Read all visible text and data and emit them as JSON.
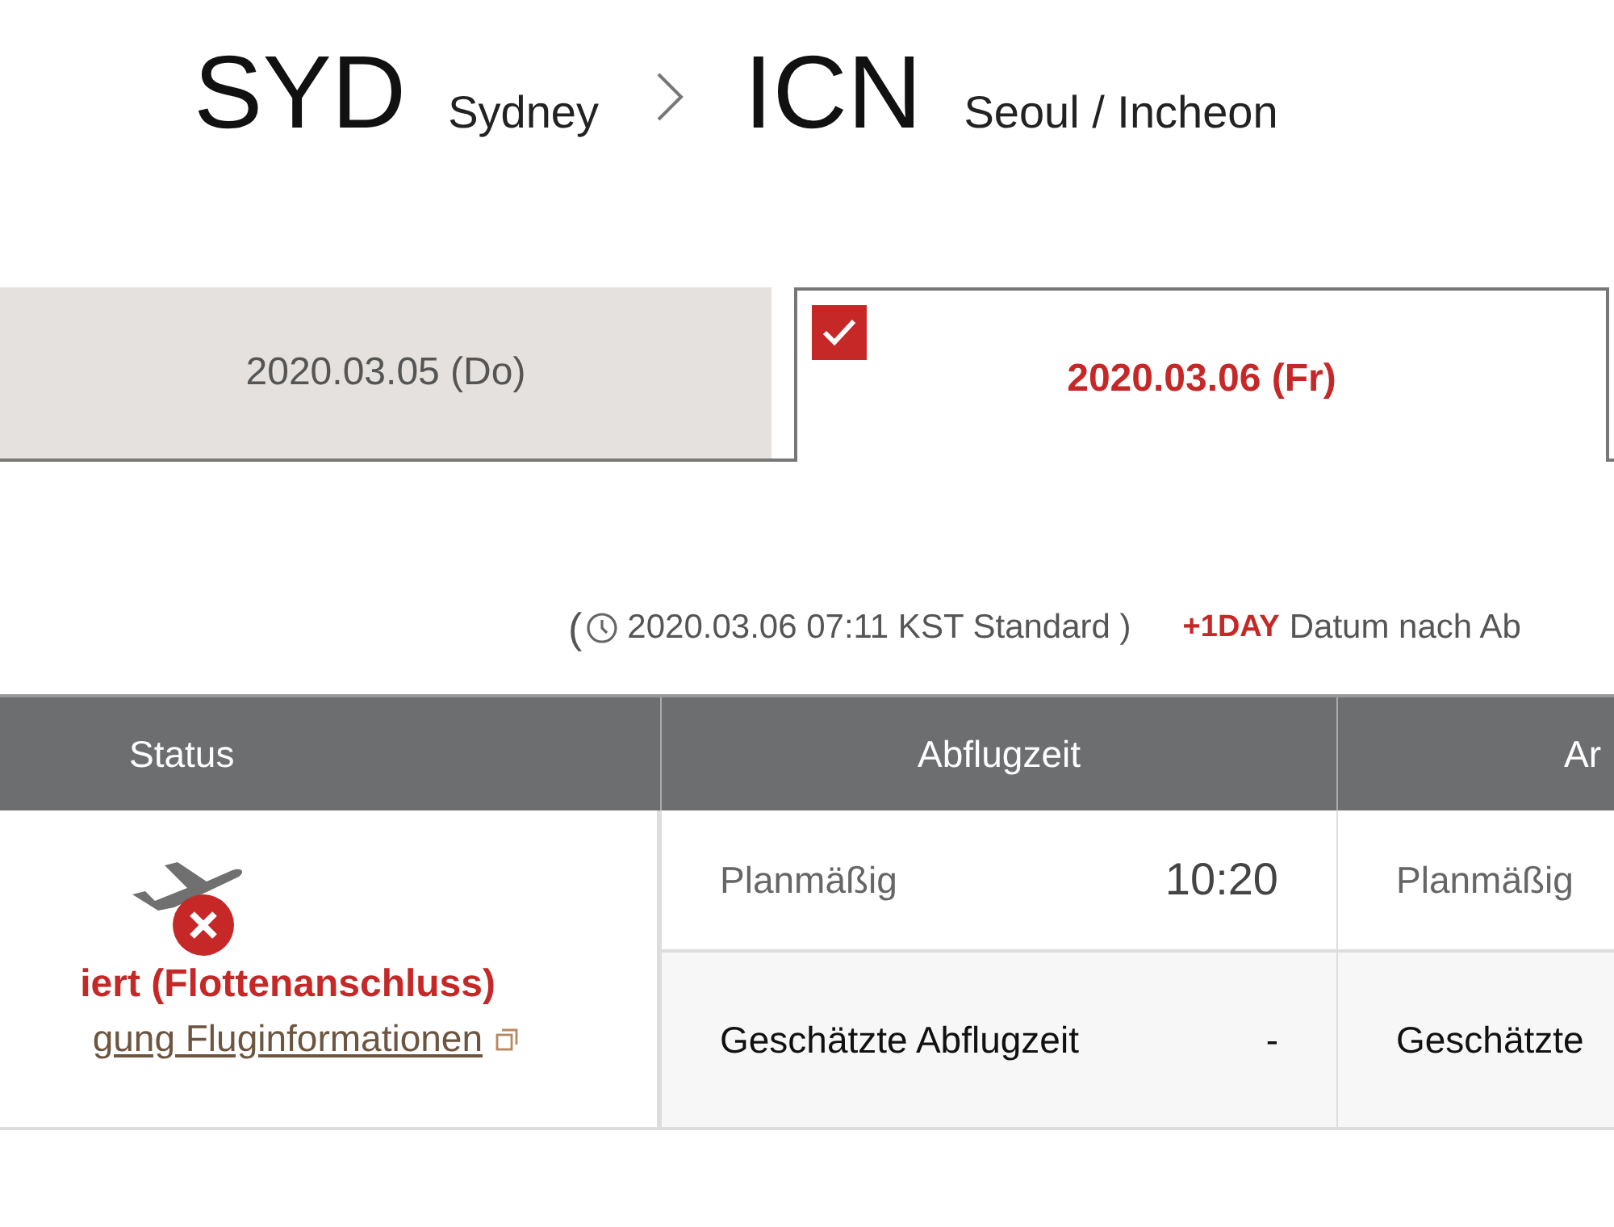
{
  "route": {
    "origin": {
      "code": "SYD",
      "city": "Sydney"
    },
    "destination": {
      "code": "ICN",
      "city": "Seoul / Incheon"
    }
  },
  "date_tabs": [
    {
      "label": "2020.03.05 (Do)",
      "selected": false
    },
    {
      "label": "2020.03.06 (Fr)",
      "selected": true
    }
  ],
  "info": {
    "open": "(",
    "time": "2020.03.06 07:11 KST Standard )",
    "badge": "+1DAY",
    "note": "Datum nach Ab"
  },
  "table": {
    "columns": [
      "Status",
      "Abflugzeit",
      "Ar"
    ],
    "status": {
      "text": "iert (Flottenanschluss)",
      "link": "gung Fluginformationen"
    },
    "rows": [
      {
        "kind": "scheduled",
        "label": "Planmäßig",
        "departure": "10:20",
        "arrival_label": "Planmäßig"
      },
      {
        "kind": "estimated",
        "label": "Geschätzte Abflugzeit",
        "departure": "-",
        "arrival_label": "Geschätzte"
      }
    ]
  }
}
